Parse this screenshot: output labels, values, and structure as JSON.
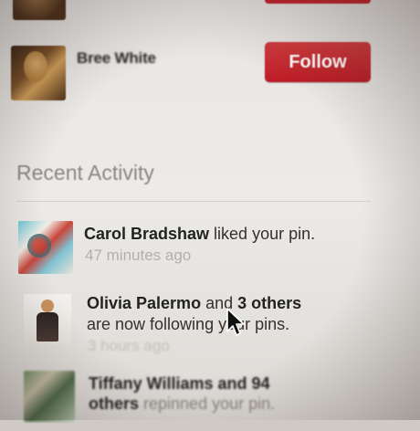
{
  "follow_suggestions": [
    {
      "name": "Bree White",
      "button_label": "Follow"
    }
  ],
  "recent_activity": {
    "title": "Recent Activity",
    "items": [
      {
        "actor": "Carol Bradshaw",
        "action": " liked your pin.",
        "time": "47 minutes ago"
      },
      {
        "actor": "Olivia Palermo",
        "connector": " and ",
        "others": "3 others",
        "action": "are now following your pins.",
        "time": "3 hours ago"
      },
      {
        "actor": "Tiffany Williams",
        "connector": " and 94",
        "others": "others",
        "action": " repinned your pin."
      }
    ]
  },
  "colors": {
    "follow_button": "#c4232c",
    "background": "#ebe8e5",
    "muted_text": "#b3afab"
  },
  "cursor": {
    "icon": "arrow-pointer-icon"
  }
}
